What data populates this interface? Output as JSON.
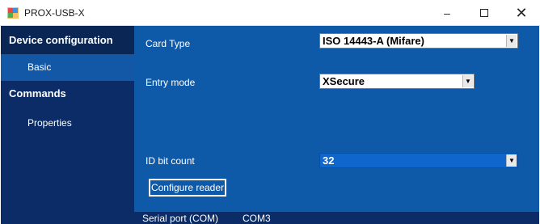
{
  "window": {
    "title": "PROX-USB-X",
    "minimize_icon": "minimize-icon",
    "maximize_icon": "maximize-icon",
    "close_icon": "close-icon",
    "minimize_glyph": "–",
    "close_glyph": "✕"
  },
  "sidebar": {
    "items": [
      {
        "label": "Device configuration",
        "type": "section"
      },
      {
        "label": "Basic",
        "type": "item",
        "selected": true
      },
      {
        "label": "Commands",
        "type": "section"
      },
      {
        "label": "Properties",
        "type": "item"
      }
    ]
  },
  "form": {
    "card_type": {
      "label": "Card Type",
      "value": "ISO 14443-A (Mifare)"
    },
    "entry_mode": {
      "label": "Entry mode",
      "value": "XSecure"
    },
    "id_bit_count": {
      "label": "ID bit count",
      "value": "32"
    },
    "configure_button": "Configure reader"
  },
  "status": {
    "port_label": "Serial port (COM)",
    "port_value": "COM3"
  },
  "colors": {
    "sidebar_bg": "#0b2c66",
    "main_bg": "#0e5aa8",
    "selected_item": "#1258a6",
    "combo_selected": "#0f66cc"
  }
}
